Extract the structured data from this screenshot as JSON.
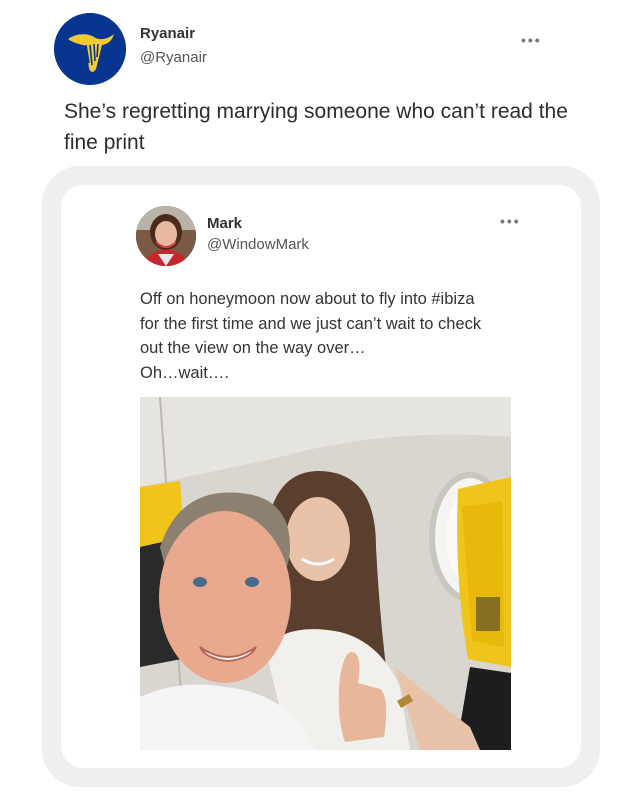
{
  "tweet": {
    "author_name": "Ryanair",
    "author_handle": "@Ryanair",
    "text": "She’s regretting marrying someone who can’t read the fine print",
    "more_label": "•••"
  },
  "quoted_tweet": {
    "author_name": "Mark",
    "author_handle": "@WindowMark",
    "text_lines": [
      "Off on honeymoon now about to fly into #ibiza",
      "for the first time and we just can’t wait to check",
      "out the view on the way over…",
      "Oh…wait…."
    ],
    "more_label": "•••"
  },
  "colors": {
    "brand_blue": "#073590",
    "brand_yellow": "#f1c933",
    "frame_gray": "#efefef"
  },
  "icons": {
    "ryanair_logo": "ryanair-harp-logo",
    "more": "more-dots-icon"
  }
}
